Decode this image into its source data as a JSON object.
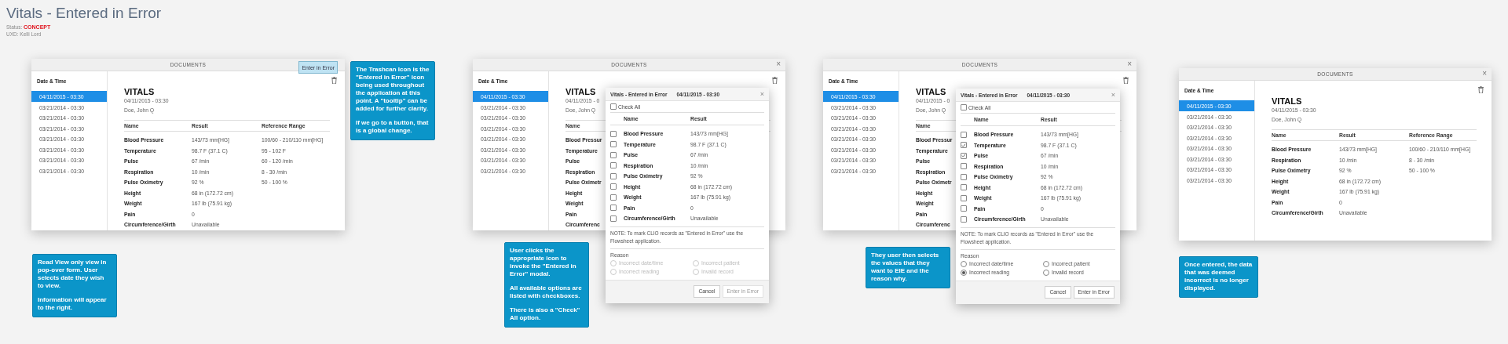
{
  "page": {
    "title": "Vitals - Entered in Error",
    "status_label": "Status:",
    "status_value": "CONCEPT",
    "author": "UXD: Kelli Lord"
  },
  "frames": [
    {
      "window": {
        "title": "DOCUMENTS"
      },
      "tooltip": "Enter in Error",
      "sidebar": {
        "heading": "Date & Time",
        "items": [
          {
            "label": "04/11/2015 - 03:30",
            "selected": true
          },
          {
            "label": "03/21/2014 - 03:30",
            "selected": false
          },
          {
            "label": "03/21/2014 - 03:30",
            "selected": false
          },
          {
            "label": "03/21/2014 - 03:30",
            "selected": false
          },
          {
            "label": "03/21/2014 - 03:30",
            "selected": false
          },
          {
            "label": "03/21/2014 - 03:30",
            "selected": false
          },
          {
            "label": "03/21/2014 - 03:30",
            "selected": false
          },
          {
            "label": "03/21/2014 - 03:30",
            "selected": false
          }
        ]
      },
      "record": {
        "title": "VITALS",
        "date": "04/11/2015 - 03:30",
        "patient": "Doe, John Q",
        "columns": [
          "Name",
          "Result",
          "Reference Range"
        ],
        "rows": [
          {
            "cells": [
              "Blood Pressure",
              "143/73 mm[HG]",
              "100/60 - 210/110 mm[HG]"
            ]
          },
          {
            "cells": [
              "Temperature",
              "98.7 F (37.1 C)",
              "95 - 102 F"
            ]
          },
          {
            "cells": [
              "Pulse",
              "67 /min",
              "60 - 120 /min"
            ]
          },
          {
            "cells": [
              "Respiration",
              "10 /min",
              "8 - 30 /min"
            ]
          },
          {
            "cells": [
              "Pulse Oximetry",
              "92 %",
              "50 - 100 %"
            ]
          },
          {
            "cells": [
              "Height",
              "68 in (172.72 cm)"
            ]
          },
          {
            "cells": [
              "Weight",
              "167 lb (75.91 kg)"
            ]
          },
          {
            "cells": [
              "Pain",
              "0"
            ]
          },
          {
            "cells": [
              "Circumference/Girth",
              "Unavailable"
            ]
          }
        ]
      },
      "notes": [
        {
          "paragraphs": [
            "The Trashcan Icon is the \"Entered in Error\" icon being used throughout the application at this point. A \"tooltip\" can be added for further clarity.",
            "If we go to a button, that is a global change."
          ]
        },
        {
          "paragraphs": [
            "Read View only view in pop-over form. User selects date they wish to view.",
            "Information will appear to the right."
          ]
        }
      ]
    },
    {
      "window": {
        "title": "DOCUMENTS",
        "close": "×"
      },
      "sidebar": {
        "heading": "Date & Time",
        "items": [
          {
            "label": "04/11/2015 - 03:30",
            "selected": true
          },
          {
            "label": "03/21/2014 - 03:30",
            "selected": false
          },
          {
            "label": "03/21/2014 - 03:30",
            "selected": false
          },
          {
            "label": "03/21/2014 - 03:30",
            "selected": false
          },
          {
            "label": "03/21/2014 - 03:30",
            "selected": false
          },
          {
            "label": "03/21/2014 - 03:30",
            "selected": false
          },
          {
            "label": "03/21/2014 - 03:30",
            "selected": false
          },
          {
            "label": "03/21/2014 - 03:30",
            "selected": false
          }
        ]
      },
      "record": {
        "title": "VITALS",
        "date": "04/11/2015 - 0",
        "patient": "Doe, John Q",
        "columns": [
          "Name"
        ],
        "rows": [
          {
            "cells": [
              "Blood Pressur"
            ]
          },
          {
            "cells": [
              "Temperature"
            ]
          },
          {
            "cells": [
              "Pulse"
            ]
          },
          {
            "cells": [
              "Respiration"
            ]
          },
          {
            "cells": [
              "Pulse Oximetr"
            ]
          },
          {
            "cells": [
              "Height"
            ]
          },
          {
            "cells": [
              "Weight"
            ]
          },
          {
            "cells": [
              "Pain"
            ]
          },
          {
            "cells": [
              "Circumferenc"
            ]
          }
        ]
      },
      "modal": {
        "title": "Vitals - Entered in Error",
        "date": "04/11/2015 - 03:30",
        "close": "×",
        "check_all": {
          "label": "Check All",
          "checked": false
        },
        "columns": [
          "Name",
          "Result"
        ],
        "rows": [
          {
            "name": "Blood Pressure",
            "result": "143/73 mm[HG]",
            "checked": false
          },
          {
            "name": "Temperature",
            "result": "98.7 F (37.1 C)",
            "checked": false
          },
          {
            "name": "Pulse",
            "result": "67 /min",
            "checked": false
          },
          {
            "name": "Respiration",
            "result": "10 /min",
            "checked": false
          },
          {
            "name": "Pulse Oximetry",
            "result": "92 %",
            "checked": false
          },
          {
            "name": "Height",
            "result": "68 in (172.72 cm)",
            "checked": false
          },
          {
            "name": "Weight",
            "result": "167 lb (75.91 kg)",
            "checked": false
          },
          {
            "name": "Pain",
            "result": "0",
            "checked": false
          },
          {
            "name": "Circumference/Girth",
            "result": "Unavailable",
            "checked": false
          }
        ],
        "note": "NOTE: To mark CLIO records as \"Entered in Error\" use the Flowsheet application.",
        "reason_label": "Reason",
        "reasons": [
          {
            "label": "Incorrect date/time",
            "selected": false,
            "disabled": true
          },
          {
            "label": "Incorrect patient",
            "selected": false,
            "disabled": true
          },
          {
            "label": "Incorrect reading",
            "selected": false,
            "disabled": true
          },
          {
            "label": "Invalid record",
            "selected": false,
            "disabled": true
          }
        ],
        "buttons": [
          {
            "label": "Cancel",
            "disabled": false
          },
          {
            "label": "Enter in Error",
            "disabled": true
          }
        ]
      },
      "notes": [
        {
          "paragraphs": [
            "User clicks the appropriate icon to invoke the \"Entered in Error\" modal.",
            "All available options are listed with checkboxes.",
            "There is also a \"Check\" All option."
          ]
        }
      ]
    },
    {
      "window": {
        "title": "DOCUMENTS",
        "close": "×"
      },
      "sidebar": {
        "heading": "Date & Time",
        "items": [
          {
            "label": "04/11/2015 - 03:30",
            "selected": true
          },
          {
            "label": "03/21/2014 - 03:30",
            "selected": false
          },
          {
            "label": "03/21/2014 - 03:30",
            "selected": false
          },
          {
            "label": "03/21/2014 - 03:30",
            "selected": false
          },
          {
            "label": "03/21/2014 - 03:30",
            "selected": false
          },
          {
            "label": "03/21/2014 - 03:30",
            "selected": false
          },
          {
            "label": "03/21/2014 - 03:30",
            "selected": false
          },
          {
            "label": "03/21/2014 - 03:30",
            "selected": false
          }
        ]
      },
      "record": {
        "title": "VITALS",
        "date": "04/11/2015 - 0",
        "patient": "Doe, John Q",
        "columns": [
          "Name"
        ],
        "rows": [
          {
            "cells": [
              "Blood Pressur"
            ]
          },
          {
            "cells": [
              "Temperature"
            ]
          },
          {
            "cells": [
              "Pulse"
            ]
          },
          {
            "cells": [
              "Respiration"
            ]
          },
          {
            "cells": [
              "Pulse Oximetr"
            ]
          },
          {
            "cells": [
              "Height"
            ]
          },
          {
            "cells": [
              "Weight"
            ]
          },
          {
            "cells": [
              "Pain"
            ]
          },
          {
            "cells": [
              "Circumferenc"
            ]
          }
        ]
      },
      "modal": {
        "title": "Vitals - Entered in Error",
        "date": "04/11/2015 - 03:30",
        "close": "×",
        "check_all": {
          "label": "Check All",
          "checked": false
        },
        "columns": [
          "Name",
          "Result"
        ],
        "rows": [
          {
            "name": "Blood Pressure",
            "result": "143/73 mm[HG]",
            "checked": false
          },
          {
            "name": "Temperature",
            "result": "98.7 F (37.1 C)",
            "checked": true
          },
          {
            "name": "Pulse",
            "result": "67 /min",
            "checked": true
          },
          {
            "name": "Respiration",
            "result": "10 /min",
            "checked": false
          },
          {
            "name": "Pulse Oximetry",
            "result": "92 %",
            "checked": false
          },
          {
            "name": "Height",
            "result": "68 in (172.72 cm)",
            "checked": false
          },
          {
            "name": "Weight",
            "result": "167 lb (75.91 kg)",
            "checked": false
          },
          {
            "name": "Pain",
            "result": "0",
            "checked": false
          },
          {
            "name": "Circumference/Girth",
            "result": "Unavailable",
            "checked": false
          }
        ],
        "note": "NOTE: To mark CLIO records as \"Entered in Error\" use the Flowsheet application.",
        "reason_label": "Reason",
        "reasons": [
          {
            "label": "Incorrect date/time",
            "selected": false,
            "disabled": false
          },
          {
            "label": "Incorrect patient",
            "selected": false,
            "disabled": false
          },
          {
            "label": "Incorrect reading",
            "selected": true,
            "disabled": false
          },
          {
            "label": "Invalid record",
            "selected": false,
            "disabled": false
          }
        ],
        "buttons": [
          {
            "label": "Cancel",
            "disabled": false
          },
          {
            "label": "Enter in Error",
            "disabled": false
          }
        ]
      },
      "notes": [
        {
          "paragraphs": [
            "They user then selects the values that they want to EIE and the reason why."
          ]
        }
      ]
    },
    {
      "window": {
        "title": "DOCUMENTS",
        "close": "×"
      },
      "sidebar": {
        "heading": "Date & Time",
        "items": [
          {
            "label": "04/11/2015 - 03:30",
            "selected": true
          },
          {
            "label": "03/21/2014 - 03:30",
            "selected": false
          },
          {
            "label": "03/21/2014 - 03:30",
            "selected": false
          },
          {
            "label": "03/21/2014 - 03:30",
            "selected": false
          },
          {
            "label": "03/21/2014 - 03:30",
            "selected": false
          },
          {
            "label": "03/21/2014 - 03:30",
            "selected": false
          },
          {
            "label": "03/21/2014 - 03:30",
            "selected": false
          },
          {
            "label": "03/21/2014 - 03:30",
            "selected": false
          }
        ]
      },
      "record": {
        "title": "VITALS",
        "date": "04/11/2015 - 03:30",
        "patient": "Doe, John Q",
        "columns": [
          "Name",
          "Result",
          "Reference Range"
        ],
        "rows": [
          {
            "cells": [
              "Blood Pressure",
              "143/73 mm[HG]",
              "100/60 - 210/110 mm[HG]"
            ]
          },
          {
            "cells": [
              "Respiration",
              "10 /min",
              "8 - 30 /min"
            ]
          },
          {
            "cells": [
              "Pulse Oximetry",
              "92 %",
              "50 - 100 %"
            ]
          },
          {
            "cells": [
              "Height",
              "68 in (172.72 cm)"
            ]
          },
          {
            "cells": [
              "Weight",
              "167 lb (75.91 kg)"
            ]
          },
          {
            "cells": [
              "Pain",
              "0"
            ]
          },
          {
            "cells": [
              "Circumference/Girth",
              "Unavailable"
            ]
          }
        ]
      },
      "notes": [
        {
          "paragraphs": [
            "Once entered, the data that was deemed incorrect is no longer displayed."
          ]
        }
      ]
    }
  ]
}
